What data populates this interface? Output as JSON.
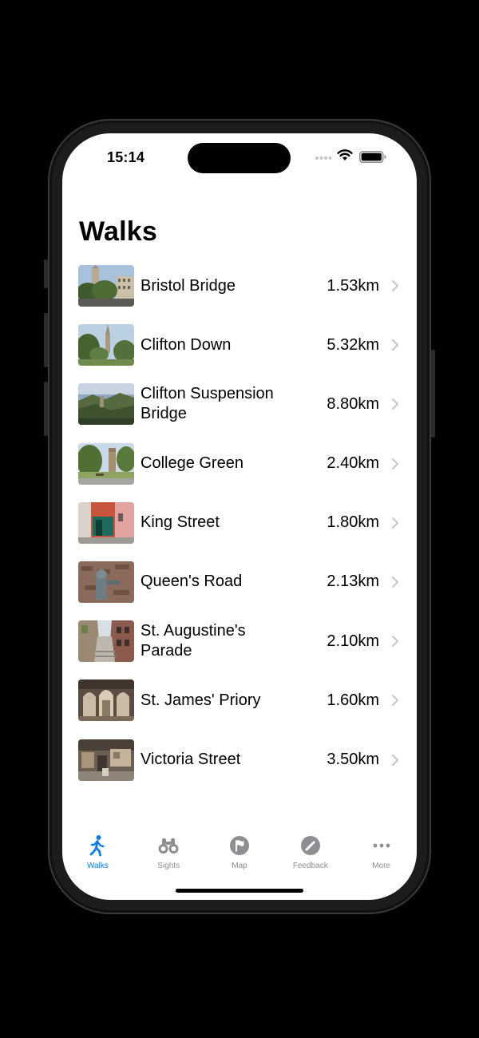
{
  "status_bar": {
    "time": "15:14",
    "icons": [
      "signal-dots-icon",
      "wifi-icon",
      "battery-icon"
    ]
  },
  "header": {
    "title": "Walks"
  },
  "walks": [
    {
      "name": "Bristol Bridge",
      "distance": "1.53km",
      "thumbnail": "church-tower-trees"
    },
    {
      "name": "Clifton Down",
      "distance": "5.32km",
      "thumbnail": "spire-among-trees"
    },
    {
      "name": "Clifton Suspension Bridge",
      "distance": "8.80km",
      "thumbnail": "gorge-landscape"
    },
    {
      "name": "College Green",
      "distance": "2.40km",
      "thumbnail": "green-with-tower"
    },
    {
      "name": "King Street",
      "distance": "1.80km",
      "thumbnail": "colorful-shopfront"
    },
    {
      "name": "Queen's Road",
      "distance": "2.13km",
      "thumbnail": "stone-statue-wall"
    },
    {
      "name": "St. Augustine's Parade",
      "distance": "2.10km",
      "thumbnail": "narrow-lane-steps"
    },
    {
      "name": "St. James' Priory",
      "distance": "1.60km",
      "thumbnail": "church-interior"
    },
    {
      "name": "Victoria Street",
      "distance": "3.50km",
      "thumbnail": "workshop-interior"
    }
  ],
  "tab_bar": {
    "active": "walks",
    "tabs": [
      {
        "id": "walks",
        "label": "Walks",
        "icon": "walking-person-icon"
      },
      {
        "id": "sights",
        "label": "Sights",
        "icon": "binoculars-icon"
      },
      {
        "id": "map",
        "label": "Map",
        "icon": "flag-icon"
      },
      {
        "id": "feedback",
        "label": "Feedback",
        "icon": "pencil-circle-icon"
      },
      {
        "id": "more",
        "label": "More",
        "icon": "ellipsis-icon"
      }
    ]
  },
  "colors": {
    "accent": "#0a7df0",
    "inactive_tab": "#8e8e93",
    "chevron": "#c4c4c7",
    "background": "#ffffff"
  }
}
